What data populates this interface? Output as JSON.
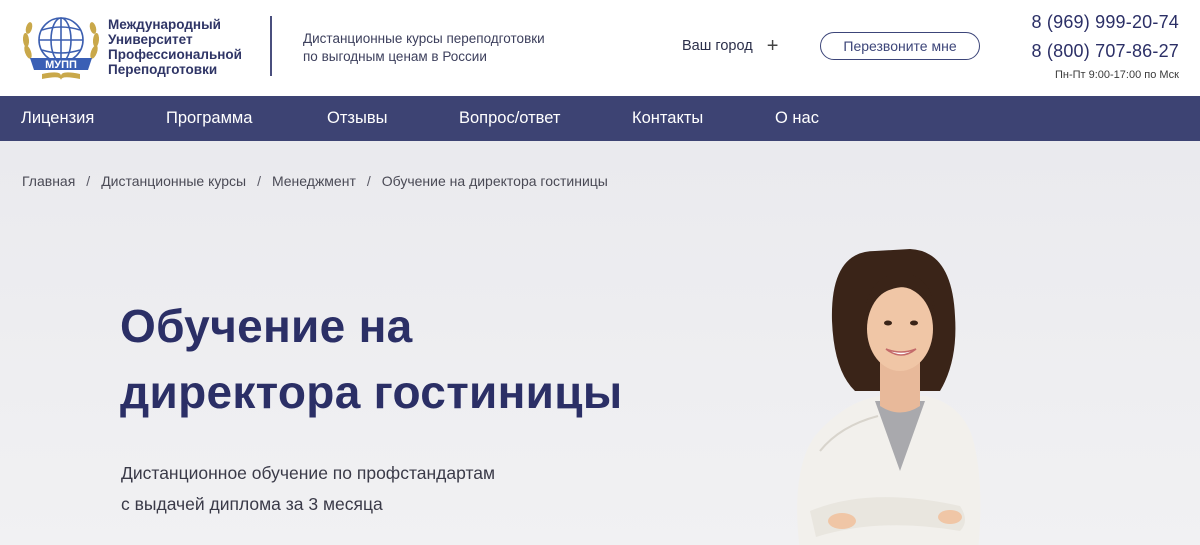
{
  "header": {
    "brand_lines": [
      "Международный",
      "Университет",
      "Профессиональной",
      "Переподготовки"
    ],
    "logo_text": "МУПП",
    "tagline_lines": [
      "Дистанционные курсы переподготовки",
      "по выгодным ценам в России"
    ],
    "city_label": "Ваш город",
    "city_plus": "+",
    "callback_label": "Перезвоните мне",
    "phones": [
      "8 (969) 999-20-74",
      "8 (800) 707-86-27"
    ],
    "hours": "Пн-Пт 9:00-17:00 по Мск"
  },
  "nav": {
    "items": [
      "Лицензия",
      "Программа",
      "Отзывы",
      "Вопрос/ответ",
      "Контакты",
      "О нас"
    ]
  },
  "breadcrumb": {
    "items": [
      "Главная",
      "Дистанционные курсы",
      "Менеджмент"
    ],
    "current": "Обучение на директора гостиницы",
    "separator": "/"
  },
  "hero": {
    "title_lines": [
      "Обучение на",
      "директора гостиницы"
    ],
    "subtitle_lines": [
      "Дистанционное обучение по профстандартам",
      "с выдачей диплома за 3 месяца"
    ]
  },
  "colors": {
    "nav_bg": "#3d4373",
    "accent": "#2b2f66",
    "hero_bg": "#eeeef0"
  }
}
